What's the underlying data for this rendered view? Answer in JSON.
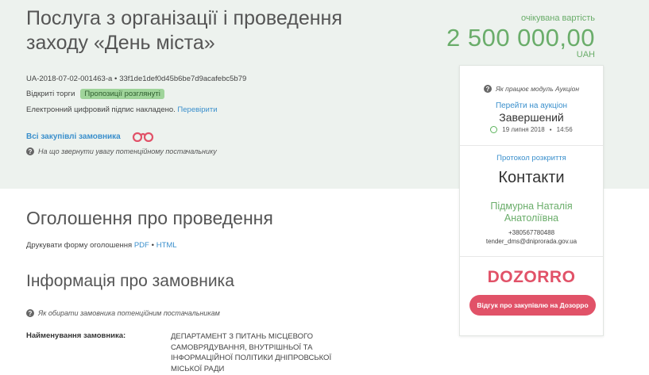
{
  "header": {
    "title": "Послуга з організації і проведення заходу «День міста»",
    "expected_cost_label": "очікувана вартість",
    "expected_cost_value": "2 500 000,00",
    "currency": "UAH"
  },
  "tender": {
    "id": "UA-2018-07-02-001463-a",
    "separator": "●",
    "hash": "33f1de1def0d45b6be7d9acafebc5b79",
    "type": "Відкриті торги",
    "status_badge": "Пропозиції розглянуті",
    "signature_text": "Електронний цифровий підпис накладено.",
    "signature_link": "Перевірити",
    "all_purchases_link": "Всі закупівлі замовника",
    "supplier_hint": "На що звернути увагу потенційному постачальнику"
  },
  "announcement": {
    "heading": "Оголошення про проведення",
    "print_label": "Друкувати форму оголошення",
    "pdf_link": "PDF",
    "dot": "●",
    "html_link": "HTML"
  },
  "customer": {
    "heading": "Інформація про замовника",
    "hint": "Як обирати замовника потенційним постачальникам",
    "name_label": "Найменування замовника:",
    "name_value": "ДЕПАРТАМЕНТ З ПИТАНЬ МІСЦЕВОГО САМОВРЯДУВАННЯ, ВНУТРІШНЬОЇ ТА ІНФОРМАЦІЙНОЇ ПОЛІТИКИ ДНІПРОВСЬКОЇ МІСЬКОЇ РАДИ"
  },
  "panel": {
    "auction_hint": "Як працює модуль Аукціон",
    "goto_auction": "Перейти на аукціон",
    "auction_status": "Завершений",
    "auction_date": "19 липня 2018",
    "date_dot": "●",
    "auction_time": "14:56",
    "protocol_link": "Протокол розкриття",
    "contacts_heading": "Контакти",
    "contact_name": "Підмурна Наталія Анатоліївна",
    "phone": "+380567780488",
    "email": "tender_dms@dniprorada.gov.ua",
    "dozorro_logo": "DOZORRO",
    "review_button": "Відгук про закупівлю на Дозорро"
  },
  "colors": {
    "accent_green": "#6aad6a",
    "link_blue": "#3a8fcc",
    "dozorro_red": "#e15268",
    "top_band": "#edf2ee"
  },
  "icons": {
    "hint": "question-circle-icon",
    "binoculars": "binoculars-icon",
    "clock": "clock-icon"
  }
}
